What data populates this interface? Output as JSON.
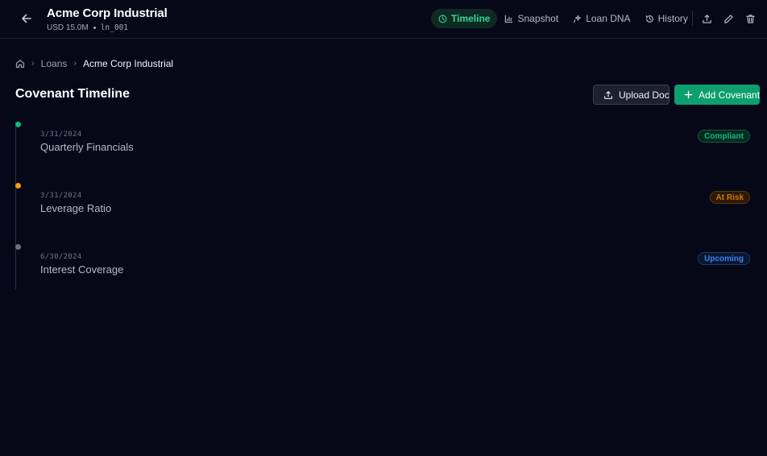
{
  "header": {
    "title": "Acme Corp Industrial",
    "amount": "USD 15.0M",
    "loan_id": "ln_001",
    "tabs": [
      {
        "label": "Timeline",
        "icon": "clock-icon",
        "active": true
      },
      {
        "label": "Snapshot",
        "icon": "bar-chart-icon",
        "active": false
      },
      {
        "label": "Loan DNA",
        "icon": "sparkle-icon",
        "active": false
      },
      {
        "label": "History",
        "icon": "history-icon",
        "active": false
      }
    ],
    "actions": [
      "upload-icon",
      "pencil-icon",
      "trash-icon"
    ]
  },
  "breadcrumb": {
    "home_icon": "home-icon",
    "items": [
      "Loans",
      "Acme Corp Industrial"
    ]
  },
  "page": {
    "title": "Covenant Timeline",
    "upload_label": "Upload Doc",
    "add_label": "Add Covenant"
  },
  "covenants": [
    {
      "date": "3/31/2024",
      "name": "Quarterly Financials",
      "status": "Compliant",
      "dot_color": "#10b981",
      "badge_color": "#10b981",
      "badge_bg": "#062a1f",
      "badge_border": "#0f5a41"
    },
    {
      "date": "3/31/2024",
      "name": "Leverage Ratio",
      "status": "At Risk",
      "dot_color": "#f59e0b",
      "badge_color": "#d97706",
      "badge_bg": "#2a1a05",
      "badge_border": "#5a3a0a"
    },
    {
      "date": "6/30/2024",
      "name": "Interest Coverage",
      "status": "Upcoming",
      "dot_color": "#6b7280",
      "badge_color": "#3b82f6",
      "badge_bg": "#0b1730",
      "badge_border": "#1d3a6a"
    }
  ],
  "colors": {
    "background": "#060818",
    "accent": "#0e9f6e",
    "active_tab": "#34d399"
  }
}
